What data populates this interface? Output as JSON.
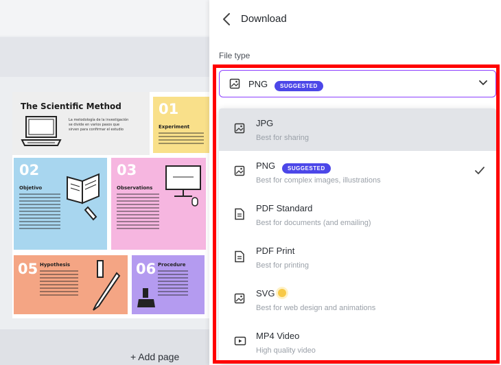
{
  "panel": {
    "title": "Download",
    "file_type_label": "File type",
    "selected": {
      "label": "PNG",
      "badge": "SUGGESTED"
    }
  },
  "options": [
    {
      "name": "JPG",
      "description": "Best for sharing",
      "icon": "image-icon"
    },
    {
      "name": "PNG",
      "badge": "SUGGESTED",
      "description": "Best for complex images, illustrations",
      "icon": "image-icon",
      "selected": true
    },
    {
      "name": "PDF Standard",
      "description": "Best for documents (and emailing)",
      "icon": "document-icon"
    },
    {
      "name": "PDF Print",
      "description": "Best for printing",
      "icon": "document-icon"
    },
    {
      "name": "SVG",
      "description": "Best for web design and animations",
      "icon": "image-icon"
    },
    {
      "name": "MP4 Video",
      "description": "High quality video",
      "icon": "video-icon"
    }
  ],
  "canvas": {
    "title": "The Scientific Method",
    "intro": "La metodología de la investigación se divide en varios pasos que sirven para confirmar el estudio",
    "cards": [
      {
        "num": "01",
        "title": "Experiment"
      },
      {
        "num": "02",
        "title": "Objetivo"
      },
      {
        "num": "03",
        "title": "Observations"
      },
      {
        "num": "05",
        "title": "Hypothesis"
      },
      {
        "num": "06",
        "title": "Procedure"
      }
    ],
    "add_page": "+ Add page"
  },
  "colors": {
    "accent": "#8b3dff",
    "badge": "#4c47e8",
    "annotation": "#ff0000"
  }
}
